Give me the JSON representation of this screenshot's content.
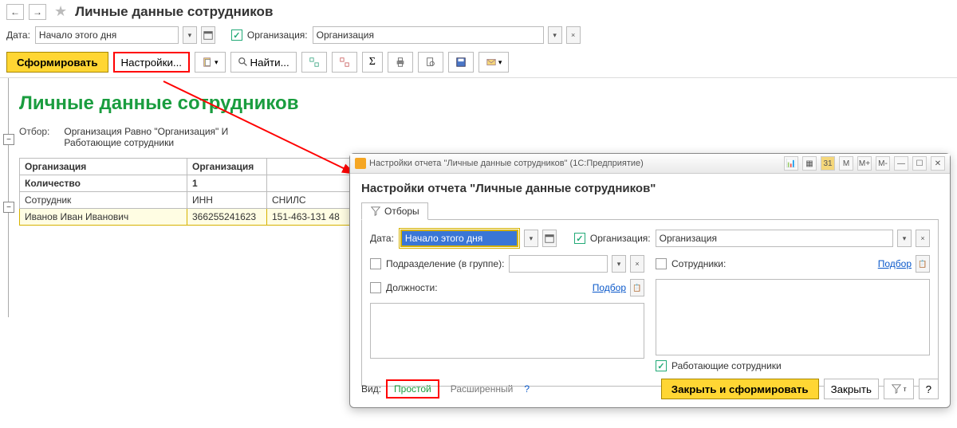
{
  "header": {
    "title": "Личные данные сотрудников"
  },
  "filter": {
    "date_label": "Дата:",
    "date_value": "Начало этого дня",
    "org_checked_label": "Организация:",
    "org_value": "Организация"
  },
  "toolbar": {
    "run": "Сформировать",
    "settings": "Настройки...",
    "find": "Найти..."
  },
  "report": {
    "title": "Личные данные сотрудников",
    "filter_label": "Отбор:",
    "filter_text_1": "Организация Равно \"Организация\" И",
    "filter_text_2": "Работающие сотрудники",
    "table": {
      "h1": "Организация",
      "h1b": "Организация",
      "h2": "Количество",
      "h2b": "1",
      "c1": "Сотрудник",
      "c2": "ИНН",
      "c3": "СНИЛС",
      "r1": {
        "c1": "Иванов Иван Иванович",
        "c2": "366255241623",
        "c3": "151-463-131 48"
      }
    }
  },
  "dialog": {
    "titlebar": "Настройки отчета \"Личные данные сотрудников\" (1С:Предприятие)",
    "heading": "Настройки отчета \"Личные данные сотрудников\"",
    "tab": "Отборы",
    "date_label": "Дата:",
    "date_value": "Начало этого дня",
    "org_label": "Организация:",
    "org_value": "Организация",
    "dept_label": "Подразделение (в группе):",
    "employees_label": "Сотрудники:",
    "positions_label": "Должности:",
    "select_link": "Подбор",
    "working_label": "Работающие сотрудники",
    "view_label": "Вид:",
    "view_simple": "Простой",
    "view_advanced": "Расширенный",
    "ok": "Закрыть и сформировать",
    "close": "Закрыть",
    "help": "?",
    "winbtns": {
      "m": "M",
      "mplus": "M+",
      "mminus": "M-"
    }
  }
}
